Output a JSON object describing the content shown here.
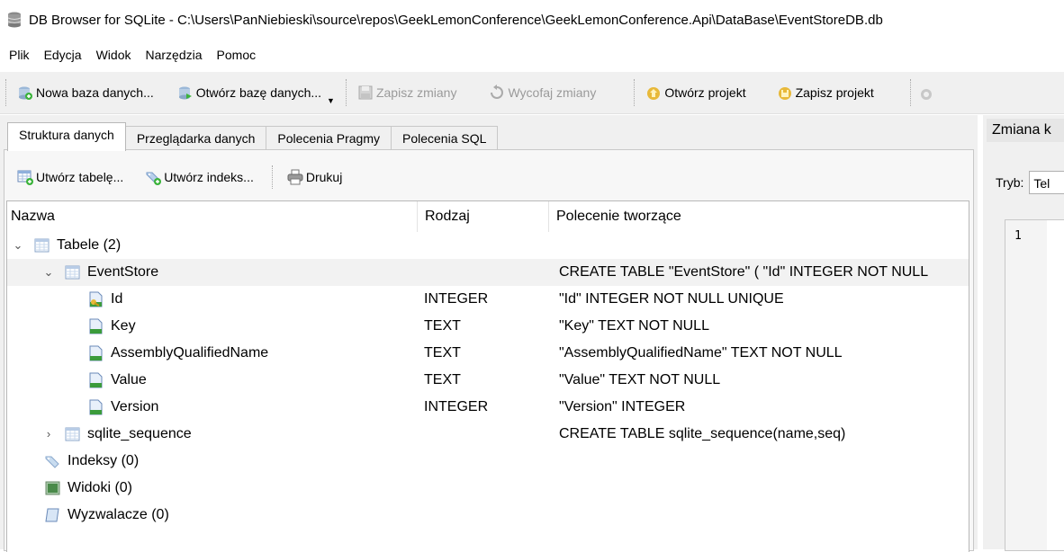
{
  "window": {
    "title": "DB Browser for SQLite - C:\\Users\\PanNiebieski\\source\\repos\\GeekLemonConference\\GeekLemonConference.Api\\DataBase\\EventStoreDB.db",
    "icon": "database-icon"
  },
  "menu": [
    "Plik",
    "Edycja",
    "Widok",
    "Narzędzia",
    "Pomoc"
  ],
  "toolbar": {
    "new_db": "Nowa baza danych...",
    "open_db": "Otwórz bazę danych...",
    "write_changes": "Zapisz zmiany",
    "revert_changes": "Wycofaj zmiany",
    "open_project": "Otwórz projekt",
    "save_project": "Zapisz projekt"
  },
  "tabs": [
    "Struktura danych",
    "Przeglądarka danych",
    "Polecenia Pragmy",
    "Polecenia SQL"
  ],
  "active_tab": "Struktura danych",
  "structure_toolbar": {
    "create_table": "Utwórz tabelę...",
    "create_index": "Utwórz indeks...",
    "print": "Drukuj"
  },
  "tree": {
    "columns": [
      "Nazwa",
      "Rodzaj",
      "Polecenie tworzące"
    ],
    "rows": [
      {
        "name": "Tabele (2)",
        "type": "",
        "schema": "",
        "arrow": "⌄",
        "icon": "table-icon"
      },
      {
        "name": "EventStore",
        "type": "",
        "schema": "CREATE TABLE \"EventStore\" ( \"Id\" INTEGER NOT NULL",
        "arrow": "⌄",
        "icon": "table-icon"
      },
      {
        "name": "Id",
        "type": "INTEGER",
        "schema": "\"Id\" INTEGER NOT NULL UNIQUE",
        "arrow": "",
        "icon": "key-field-icon"
      },
      {
        "name": "Key",
        "type": "TEXT",
        "schema": "\"Key\" TEXT NOT NULL",
        "arrow": "",
        "icon": "field-icon"
      },
      {
        "name": "AssemblyQualifiedName",
        "type": "TEXT",
        "schema": "\"AssemblyQualifiedName\" TEXT NOT NULL",
        "arrow": "",
        "icon": "field-icon"
      },
      {
        "name": "Value",
        "type": "TEXT",
        "schema": "\"Value\" TEXT NOT NULL",
        "arrow": "",
        "icon": "field-icon"
      },
      {
        "name": "Version",
        "type": "INTEGER",
        "schema": "\"Version\" INTEGER",
        "arrow": "",
        "icon": "field-icon"
      },
      {
        "name": "sqlite_sequence",
        "type": "",
        "schema": "CREATE TABLE sqlite_sequence(name,seq)",
        "arrow": "›",
        "icon": "table-icon"
      },
      {
        "name": "Indeksy (0)",
        "type": "",
        "schema": "",
        "arrow": "",
        "icon": "index-icon"
      },
      {
        "name": "Widoki (0)",
        "type": "",
        "schema": "",
        "arrow": "",
        "icon": "view-icon"
      },
      {
        "name": "Wyzwalacze (0)",
        "type": "",
        "schema": "",
        "arrow": "",
        "icon": "trigger-icon"
      }
    ]
  },
  "edit_cell": {
    "title": "Zmiana k",
    "mode_label": "Tryb:",
    "mode_value": "Tel",
    "line_number": "1"
  }
}
